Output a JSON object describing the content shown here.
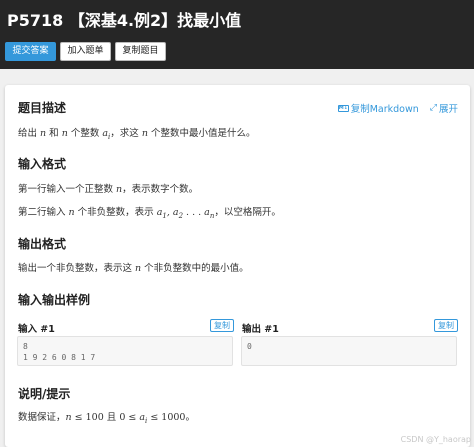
{
  "header": {
    "title": "P5718 【深基4.例2】找最小值",
    "buttons": {
      "submit": "提交答案",
      "add_to_list": "加入题单",
      "copy_problem": "复制题目"
    }
  },
  "toolbar": {
    "copy_markdown": "复制Markdown",
    "expand": "展开",
    "md_icon": "M↓",
    "expand_icon": "⤢"
  },
  "sections": {
    "description": {
      "heading": "题目描述",
      "text": {
        "a": "给出 ",
        "b": "n",
        "c": " 和 ",
        "d": "n",
        "e": " 个整数 ",
        "f": "a",
        "g": "i",
        "h": "，求这 ",
        "i": "n",
        "j": " 个整数中最小值是什么。"
      }
    },
    "input_format": {
      "heading": "输入格式",
      "line1": {
        "a": "第一行输入一个正整数 ",
        "b": "n",
        "c": "，表示数字个数。"
      },
      "line2": {
        "a": "第二行输入 ",
        "b": "n",
        "c": " 个非负整数，表示 ",
        "d": "a",
        "e": "1",
        "f": ", ",
        "g": "a",
        "h": "2",
        "i": " . . . ",
        "j": "a",
        "k": "n",
        "l": "，以空格隔开。"
      }
    },
    "output_format": {
      "heading": "输出格式",
      "text": {
        "a": "输出一个非负整数，表示这 ",
        "b": "n",
        "c": " 个非负整数中的最小值。"
      }
    },
    "samples": {
      "heading": "输入输出样例",
      "input_label": "输入 #1",
      "output_label": "输出 #1",
      "copy_label": "复制",
      "input_value": "8\n1 9 2 6 0 8 1 7",
      "output_value": "0"
    },
    "hint": {
      "heading": "说明/提示",
      "text": {
        "a": "数据保证，",
        "b": "n",
        "c": " ≤ 100",
        "d": " 且 ",
        "e": "0 ≤ ",
        "f": "a",
        "g": "i",
        "h": " ≤ 1000",
        "i": "。"
      }
    }
  },
  "watermark": "CSDN @Y_haorap"
}
